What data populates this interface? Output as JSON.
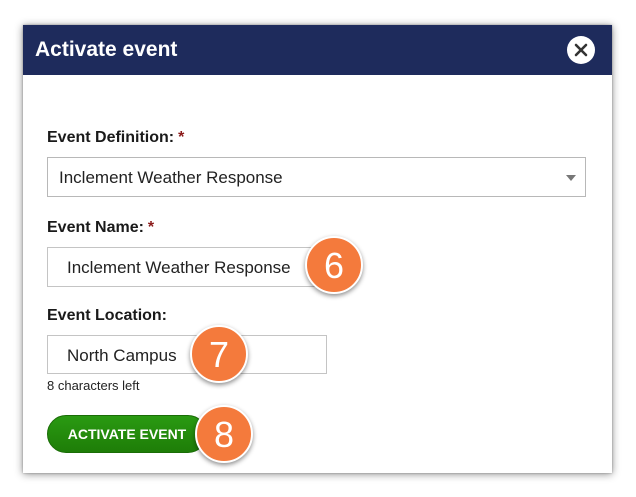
{
  "dialog": {
    "title": "Activate event",
    "close_icon": "close-icon"
  },
  "form": {
    "event_definition": {
      "label": "Event Definition:",
      "required_mark": "*",
      "value": "Inclement Weather Response"
    },
    "event_name": {
      "label": "Event Name:",
      "required_mark": "*",
      "value": "Inclement Weather Response"
    },
    "event_location": {
      "label": "Event Location:",
      "value": "North Campus",
      "hint": "8 characters left"
    },
    "submit_label": "ACTIVATE EVENT"
  },
  "callouts": [
    "6",
    "7",
    "8"
  ],
  "colors": {
    "titlebar": "#1e2b5c",
    "button": "#238a0e",
    "callout": "#f47a3c",
    "required": "#8b1a1a"
  }
}
